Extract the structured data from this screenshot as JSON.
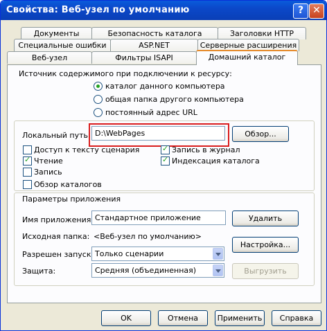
{
  "window": {
    "title": "Свойства: Веб-узел по умолчанию",
    "help_glyph": "?",
    "close_glyph": "✕"
  },
  "tabs": {
    "row1": [
      "Документы",
      "Безопасность каталога",
      "Заголовки HTTP"
    ],
    "row2": [
      "Специальные ошибки",
      "ASP.NET",
      "Серверные расширения"
    ],
    "row3": [
      "Веб-узел",
      "Фильтры ISAPI",
      "Домашний каталог"
    ],
    "active": "Домашний каталог"
  },
  "source": {
    "label": "Источник содержимого при подключении к ресурсу:",
    "options": [
      "каталог данного компьютера",
      "общая папка другого компьютера",
      "постоянный адрес URL"
    ],
    "selected": 0
  },
  "local_path": {
    "label": "Локальный путь:",
    "value": "D:\\WebPages",
    "browse": "Обзор..."
  },
  "access": {
    "script_source": {
      "label": "Доступ к тексту сценария",
      "checked": false
    },
    "read": {
      "label": "Чтение",
      "checked": true
    },
    "write": {
      "label": "Запись",
      "checked": false
    },
    "dir_browse": {
      "label": "Обзор каталогов",
      "checked": false
    },
    "log": {
      "label": "Запись в журнал",
      "checked": true
    },
    "index": {
      "label": "Индексация каталога",
      "checked": true
    }
  },
  "app": {
    "section_label": "Параметры приложения",
    "name_label": "Имя приложения:",
    "name_value": "Стандартное приложение",
    "remove": "Удалить",
    "start_label": "Исходная папка:",
    "start_value": "<Веб-узел по умолчанию>",
    "config": "Настройка...",
    "exec_label": "Разрешен запуск:",
    "exec_value": "Только сценарии",
    "protect_label": "Защита:",
    "protect_value": "Средняя (объединенная)",
    "unload": "Выгрузить"
  },
  "buttons": {
    "ok": "OK",
    "cancel": "Отмена",
    "apply": "Применить",
    "help": "Справка"
  },
  "colors": {
    "titlebar": "#0a50d0",
    "highlight": "#d91d1d",
    "window_bg": "#ece9d8"
  }
}
